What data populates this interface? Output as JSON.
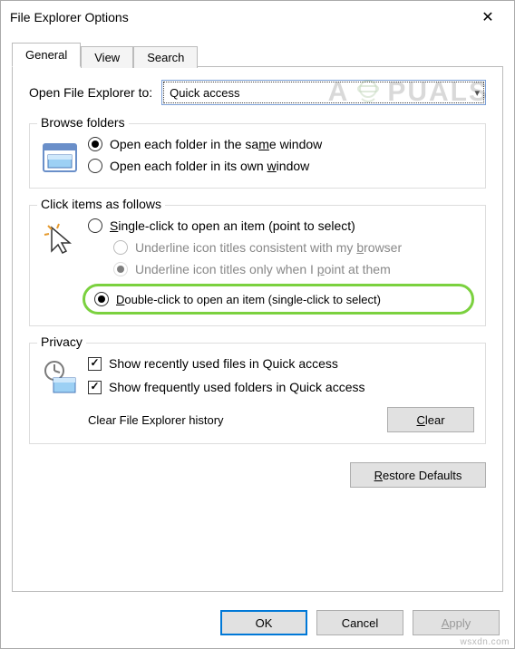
{
  "window": {
    "title": "File Explorer Options"
  },
  "tabs": {
    "general": "General",
    "view": "View",
    "search": "Search"
  },
  "open_row": {
    "label": "Open File Explorer to:",
    "value": "Quick access"
  },
  "browse": {
    "legend": "Browse folders",
    "same": "Open each folder in the sa",
    "same_u": "m",
    "same_after": "e window",
    "own": "Open each folder in its own ",
    "own_u": "w",
    "own_after": "indow"
  },
  "click": {
    "legend": "Click items as follows",
    "single_u": "S",
    "single": "ingle-click to open an item (point to select)",
    "u1": "Underline icon titles consistent with my ",
    "u1_u": "b",
    "u1_after": "rowser",
    "u2": "Underline icon titles only when I ",
    "u2_u": "p",
    "u2_after": "oint at them",
    "double_u": "D",
    "double": "ouble-click to open an item (single-click to select)"
  },
  "privacy": {
    "legend": "Privacy",
    "recent": "Show recently used files in Quick access",
    "frequent": "Show frequently used folders in Quick access",
    "clear_label": "Clear File Explorer history",
    "clear_btn_u": "C",
    "clear_btn": "lear"
  },
  "restore": {
    "u": "R",
    "label": "estore Defaults"
  },
  "footer": {
    "ok": "OK",
    "cancel": "Cancel",
    "apply_u": "A",
    "apply": "pply"
  },
  "watermark": {
    "pre": "A",
    "post": "PUALS"
  },
  "footnote": "wsxdn.com"
}
